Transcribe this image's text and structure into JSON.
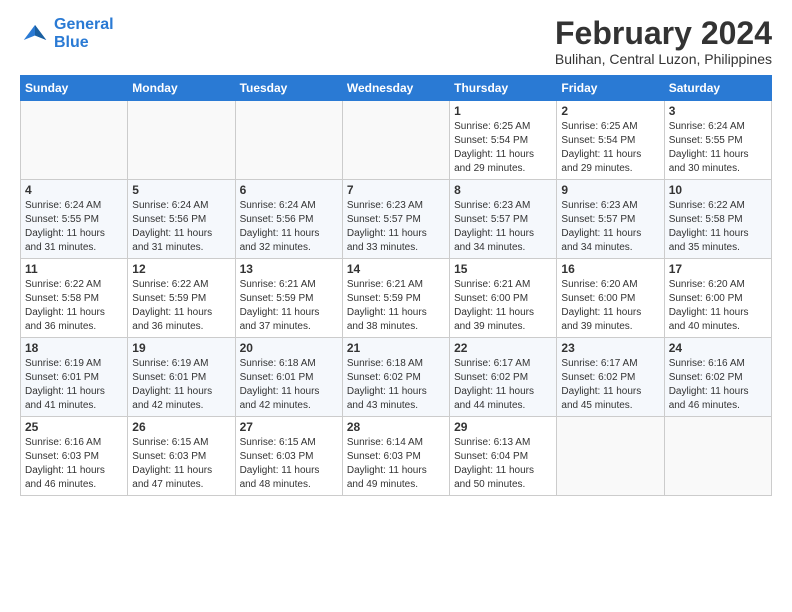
{
  "logo": {
    "line1": "General",
    "line2": "Blue"
  },
  "title": "February 2024",
  "location": "Bulihan, Central Luzon, Philippines",
  "days_header": [
    "Sunday",
    "Monday",
    "Tuesday",
    "Wednesday",
    "Thursday",
    "Friday",
    "Saturday"
  ],
  "weeks": [
    [
      {
        "day": "",
        "info": ""
      },
      {
        "day": "",
        "info": ""
      },
      {
        "day": "",
        "info": ""
      },
      {
        "day": "",
        "info": ""
      },
      {
        "day": "1",
        "info": "Sunrise: 6:25 AM\nSunset: 5:54 PM\nDaylight: 11 hours\nand 29 minutes."
      },
      {
        "day": "2",
        "info": "Sunrise: 6:25 AM\nSunset: 5:54 PM\nDaylight: 11 hours\nand 29 minutes."
      },
      {
        "day": "3",
        "info": "Sunrise: 6:24 AM\nSunset: 5:55 PM\nDaylight: 11 hours\nand 30 minutes."
      }
    ],
    [
      {
        "day": "4",
        "info": "Sunrise: 6:24 AM\nSunset: 5:55 PM\nDaylight: 11 hours\nand 31 minutes."
      },
      {
        "day": "5",
        "info": "Sunrise: 6:24 AM\nSunset: 5:56 PM\nDaylight: 11 hours\nand 31 minutes."
      },
      {
        "day": "6",
        "info": "Sunrise: 6:24 AM\nSunset: 5:56 PM\nDaylight: 11 hours\nand 32 minutes."
      },
      {
        "day": "7",
        "info": "Sunrise: 6:23 AM\nSunset: 5:57 PM\nDaylight: 11 hours\nand 33 minutes."
      },
      {
        "day": "8",
        "info": "Sunrise: 6:23 AM\nSunset: 5:57 PM\nDaylight: 11 hours\nand 34 minutes."
      },
      {
        "day": "9",
        "info": "Sunrise: 6:23 AM\nSunset: 5:57 PM\nDaylight: 11 hours\nand 34 minutes."
      },
      {
        "day": "10",
        "info": "Sunrise: 6:22 AM\nSunset: 5:58 PM\nDaylight: 11 hours\nand 35 minutes."
      }
    ],
    [
      {
        "day": "11",
        "info": "Sunrise: 6:22 AM\nSunset: 5:58 PM\nDaylight: 11 hours\nand 36 minutes."
      },
      {
        "day": "12",
        "info": "Sunrise: 6:22 AM\nSunset: 5:59 PM\nDaylight: 11 hours\nand 36 minutes."
      },
      {
        "day": "13",
        "info": "Sunrise: 6:21 AM\nSunset: 5:59 PM\nDaylight: 11 hours\nand 37 minutes."
      },
      {
        "day": "14",
        "info": "Sunrise: 6:21 AM\nSunset: 5:59 PM\nDaylight: 11 hours\nand 38 minutes."
      },
      {
        "day": "15",
        "info": "Sunrise: 6:21 AM\nSunset: 6:00 PM\nDaylight: 11 hours\nand 39 minutes."
      },
      {
        "day": "16",
        "info": "Sunrise: 6:20 AM\nSunset: 6:00 PM\nDaylight: 11 hours\nand 39 minutes."
      },
      {
        "day": "17",
        "info": "Sunrise: 6:20 AM\nSunset: 6:00 PM\nDaylight: 11 hours\nand 40 minutes."
      }
    ],
    [
      {
        "day": "18",
        "info": "Sunrise: 6:19 AM\nSunset: 6:01 PM\nDaylight: 11 hours\nand 41 minutes."
      },
      {
        "day": "19",
        "info": "Sunrise: 6:19 AM\nSunset: 6:01 PM\nDaylight: 11 hours\nand 42 minutes."
      },
      {
        "day": "20",
        "info": "Sunrise: 6:18 AM\nSunset: 6:01 PM\nDaylight: 11 hours\nand 42 minutes."
      },
      {
        "day": "21",
        "info": "Sunrise: 6:18 AM\nSunset: 6:02 PM\nDaylight: 11 hours\nand 43 minutes."
      },
      {
        "day": "22",
        "info": "Sunrise: 6:17 AM\nSunset: 6:02 PM\nDaylight: 11 hours\nand 44 minutes."
      },
      {
        "day": "23",
        "info": "Sunrise: 6:17 AM\nSunset: 6:02 PM\nDaylight: 11 hours\nand 45 minutes."
      },
      {
        "day": "24",
        "info": "Sunrise: 6:16 AM\nSunset: 6:02 PM\nDaylight: 11 hours\nand 46 minutes."
      }
    ],
    [
      {
        "day": "25",
        "info": "Sunrise: 6:16 AM\nSunset: 6:03 PM\nDaylight: 11 hours\nand 46 minutes."
      },
      {
        "day": "26",
        "info": "Sunrise: 6:15 AM\nSunset: 6:03 PM\nDaylight: 11 hours\nand 47 minutes."
      },
      {
        "day": "27",
        "info": "Sunrise: 6:15 AM\nSunset: 6:03 PM\nDaylight: 11 hours\nand 48 minutes."
      },
      {
        "day": "28",
        "info": "Sunrise: 6:14 AM\nSunset: 6:03 PM\nDaylight: 11 hours\nand 49 minutes."
      },
      {
        "day": "29",
        "info": "Sunrise: 6:13 AM\nSunset: 6:04 PM\nDaylight: 11 hours\nand 50 minutes."
      },
      {
        "day": "",
        "info": ""
      },
      {
        "day": "",
        "info": ""
      }
    ]
  ]
}
